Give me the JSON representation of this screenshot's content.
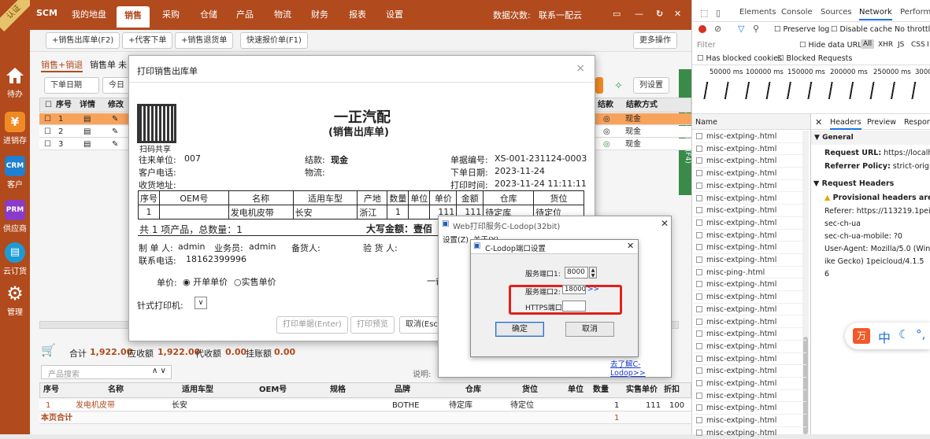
{
  "sidebar": {
    "corner_badge": "认证",
    "items": [
      {
        "label": "待办",
        "icon": "home-icon"
      },
      {
        "label": "进销存",
        "icon": "yen-icon",
        "glyph": "¥"
      },
      {
        "label": "客户",
        "icon": "crm-icon",
        "glyph": "CRM"
      },
      {
        "label": "供应商",
        "icon": "prm-icon",
        "glyph": "PRM"
      },
      {
        "label": "云订货",
        "icon": "cloud-order-icon",
        "glyph": "▤"
      },
      {
        "label": "管理",
        "icon": "gear-icon",
        "glyph": "⚙"
      }
    ]
  },
  "topnav": {
    "brand": "SCM",
    "items": [
      "我的地盘",
      "销售",
      "采购",
      "仓储",
      "产品",
      "物流",
      "财务",
      "报表",
      "设置"
    ],
    "active": "销售",
    "data_count_label": "数据次数:",
    "contact": "联系一配云"
  },
  "toolbar": {
    "buttons": [
      "+销售出库单(F2)",
      "+代客下单",
      "+销售退货单",
      "快速报价单(F1)"
    ],
    "more": "更多操作"
  },
  "content": {
    "subtabs": [
      "销售+销退",
      "销售单",
      "未"
    ],
    "filter": {
      "date_select": "下单日期",
      "today": "今日"
    },
    "column_settings": "列设置",
    "side_panel_label": "产品信息面板(F4)",
    "grid_headers": [
      "序号",
      "详情",
      "修改",
      "结款",
      "结款方式"
    ],
    "grid_rows": [
      {
        "no": "1",
        "method": "现金"
      },
      {
        "no": "2",
        "method": "现金"
      },
      {
        "no": "3",
        "method": "现金"
      }
    ],
    "summary": {
      "total_label": "合计",
      "total": "1,922.00",
      "amount_label": "应收额",
      "amount": "1,922.00",
      "pay_label": "代收额",
      "pay": "0.00",
      "arrears_label": "挂账额",
      "arrears": "0.00"
    },
    "search_placeholder": "产品搜索",
    "note_label": "说明:",
    "detail_headers": [
      "序号",
      "名称",
      "适用车型",
      "OEM号",
      "规格",
      "品牌",
      "仓库",
      "货位",
      "单位",
      "数量",
      "实售单价",
      "折扣"
    ],
    "detail_row": {
      "no": "1",
      "name": "发电机皮带",
      "car": "长安",
      "brand": "BOTHE",
      "warehouse": "待定库",
      "location": "待定位",
      "qty": "1",
      "price": "111",
      "discount": "100"
    },
    "page_total": "本页合计",
    "page_total_qty": "1"
  },
  "print_dialog": {
    "title": "打印销售出库单",
    "close": "×",
    "qr_label": "扫码共享",
    "company": "一正汽配",
    "doc_type": "(销售出库单)",
    "fields": {
      "to_label": "往来单位:",
      "to": "007",
      "settle_label": "结款:",
      "settle": "现金",
      "docno_label": "单据编号:",
      "docno": "XS-001-231124-0003",
      "phone_label": "客户电话:",
      "logistics_label": "物流:",
      "order_date_label": "下单日期:",
      "order_date": "2023-11-24",
      "addr_label": "收货地址:",
      "print_time_label": "打印时间:",
      "print_time": "2023-11-24 11:11:11"
    },
    "table_headers": [
      "序号",
      "OEM号",
      "名称",
      "适用车型",
      "产地",
      "数量",
      "单位",
      "单价",
      "金额",
      "仓库",
      "货位"
    ],
    "table_row": [
      "1",
      "",
      "发电机皮带",
      "长安",
      "浙江",
      "1",
      "",
      "111",
      "111",
      "待定库",
      "待定位"
    ],
    "summary_text": "共 1 项产品，总数量：1",
    "big_amount_label": "大写金额：壹佰",
    "maker_label": "制 单 人:",
    "maker": "admin",
    "sales_label": "业务员:",
    "sales": "admin",
    "stock_label": "备货人:",
    "check_label": "验 货 人:",
    "contact_label": "联系电话:",
    "contact": "18162399996",
    "price_label": "单价:",
    "price_opt1": "开单单价",
    "price_opt2": "实售单价",
    "extra": "一备",
    "printer_label": "针式打印机:",
    "buttons": [
      "打印单据(Enter)",
      "打印预览",
      "取消(Esc)"
    ]
  },
  "lodop": {
    "title": "Web打印服务C-Lodop(32bit)",
    "menu": [
      "设置(Z)",
      "关于(Y)"
    ],
    "link": "去了解C-Lodop>>",
    "port_dialog": {
      "title": "C-Lodop端口设置",
      "port1_label": "服务端口1:",
      "port1": "8000",
      "port2_label": "服务端口2:",
      "port2": "18000",
      "port2_more": ">>",
      "https_label": "HTTPS端口:",
      "https": "",
      "ok": "确定",
      "cancel": "取消"
    }
  },
  "devtools": {
    "tabs": [
      "Elements",
      "Console",
      "Sources",
      "Network",
      "Performan"
    ],
    "active_tab": "Network",
    "preserve_log": "Preserve log",
    "disable_cache": "Disable cache",
    "throttling": "No throttlin",
    "filter_placeholder": "Filter",
    "hide_data_urls": "Hide data URLs",
    "filter_types": [
      "All",
      "XHR",
      "JS",
      "CSS",
      "I"
    ],
    "has_blocked": "Has blocked cookies",
    "blocked_requests": "Blocked Requests",
    "timeline": [
      "50000 ms",
      "100000 ms",
      "150000 ms",
      "200000 ms",
      "250000 ms",
      "30000"
    ],
    "name_header": "Name",
    "requests": [
      "misc-extping-.html",
      "misc-extping-.html",
      "misc-extping-.html",
      "misc-extping-.html",
      "misc-extping-.html",
      "misc-extping-.html",
      "misc-extping-.html",
      "misc-extping-.html",
      "misc-extping-.html",
      "misc-extping-.html",
      "misc-extping-.html",
      "misc-ping-.html",
      "misc-extping-.html",
      "misc-extping-.html",
      "misc-extping-.html",
      "misc-extping-.html",
      "misc-extping-.html",
      "misc-extping-.html",
      "misc-extping-.html",
      "misc-extping-.html",
      "misc-extping-.html",
      "misc-extping-.html",
      "misc-extping-.html",
      "misc-extping-.html",
      "misc-extping-.html"
    ],
    "detail_tabs": [
      "Headers",
      "Preview",
      "Response"
    ],
    "general_label": "General",
    "request_url_label": "Request URL:",
    "request_url": "https://localho",
    "referrer_policy_label": "Referrer Policy:",
    "referrer_policy": "strict-origin",
    "request_headers_label": "Request Headers",
    "provisional": "Provisional headers are show",
    "referer_label": "Referer:",
    "referer": "https://113219.1pei",
    "sec_ch_ua": "sec-ch-ua",
    "sec_ch_ua_mobile": "sec-ch-ua-mobile:",
    "mobile_val": "?0",
    "user_agent_label": "User-Agent:",
    "user_agent": "Mozilla/5.0 (Win",
    "ua_cont1": "ike Gecko) 1peicloud/4.1.5",
    "ua_cont2": "6",
    "ime": "中"
  }
}
